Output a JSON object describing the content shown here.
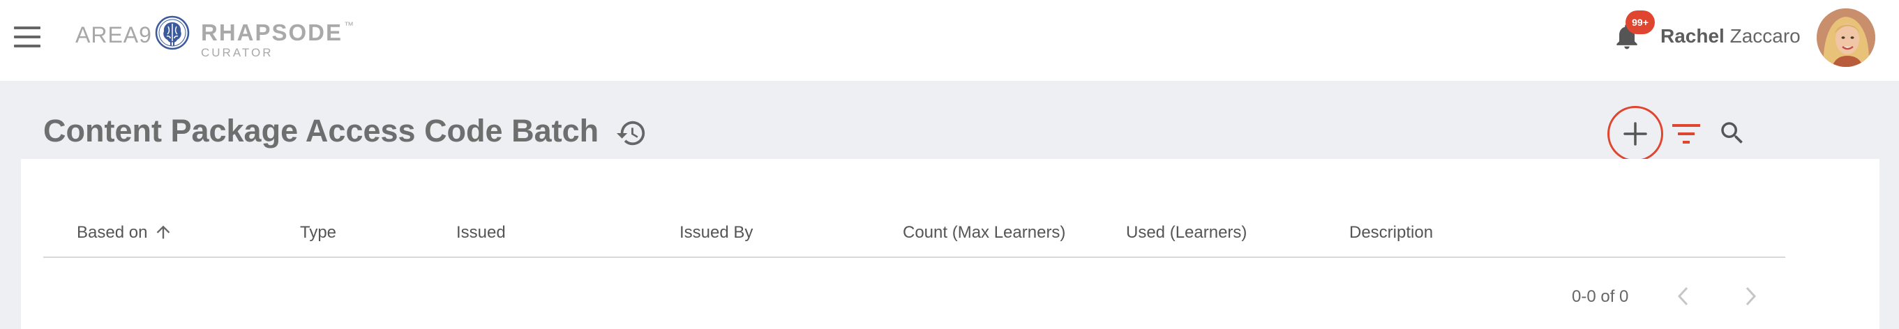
{
  "header": {
    "brand": {
      "area9": "AREA9",
      "name": "RHAPSODE",
      "tm": "™",
      "product": "CURATOR"
    },
    "notifications": {
      "badge": "99+"
    },
    "user": {
      "first_name": "Rachel",
      "last_name": "Zaccaro"
    }
  },
  "page": {
    "title": "Content Package Access Code Batch"
  },
  "table": {
    "columns": [
      {
        "label": "Based on",
        "sorted": "ascending"
      },
      {
        "label": "Type"
      },
      {
        "label": "Issued"
      },
      {
        "label": "Issued By"
      },
      {
        "label": "Count (Max Learners)"
      },
      {
        "label": "Used (Learners)"
      },
      {
        "label": "Description"
      }
    ],
    "rows": []
  },
  "pagination": {
    "range": "0-0 of 0"
  },
  "colors": {
    "accent": "#e0452f",
    "header_bg": "#ffffff",
    "page_bg": "#eeeff3",
    "text": "#555555",
    "brand_blue": "#3a5a9c"
  },
  "icons": {
    "menu": "hamburger-icon",
    "logo": "brain-logo-icon",
    "notifications": "bell-icon",
    "history": "history-icon",
    "add": "plus-icon",
    "filter": "filter-icon",
    "search": "search-icon",
    "sort": "arrow-up-icon",
    "prev": "chevron-left-icon",
    "next": "chevron-right-icon"
  }
}
